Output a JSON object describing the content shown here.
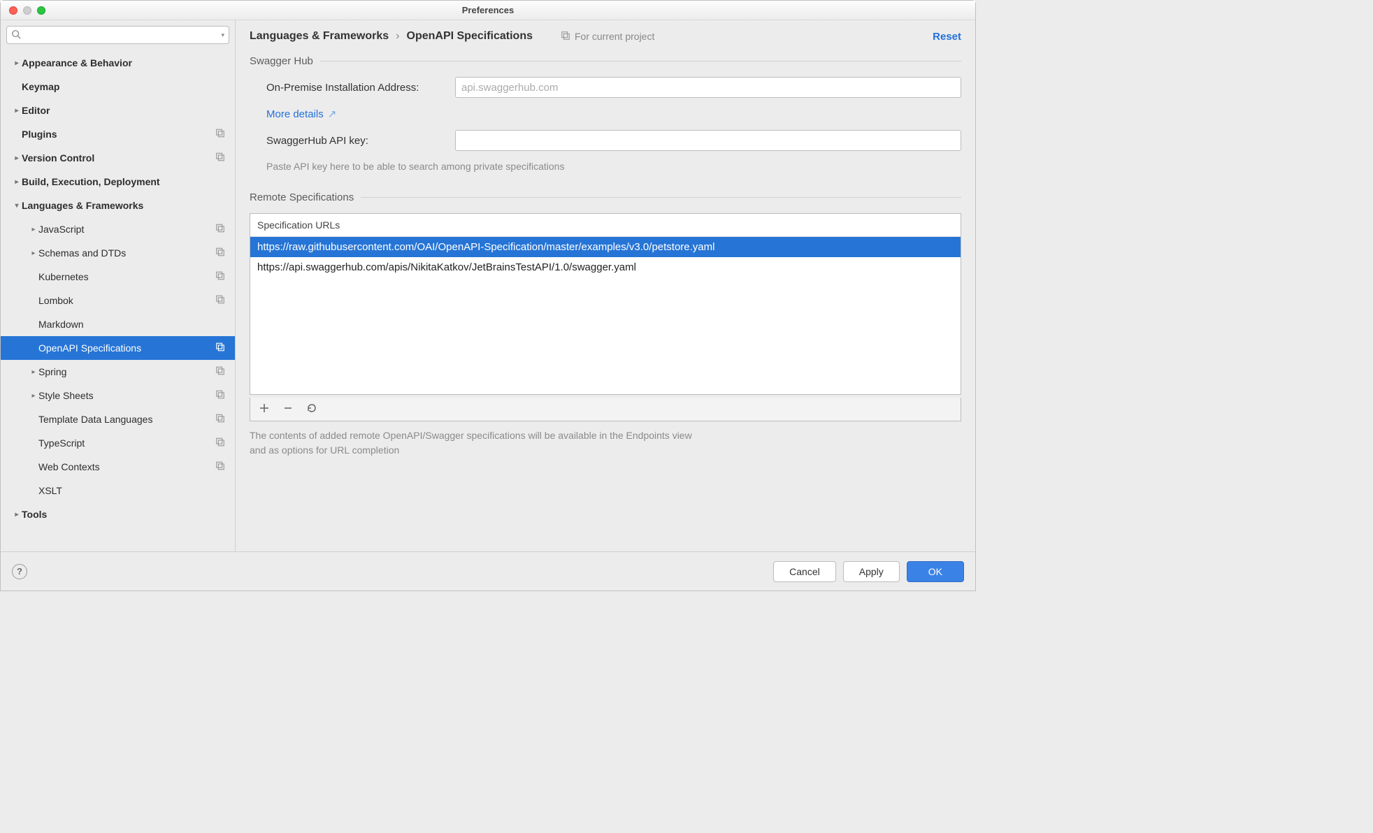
{
  "window": {
    "title": "Preferences"
  },
  "breadcrumb": {
    "parent": "Languages & Frameworks",
    "current": "OpenAPI Specifications"
  },
  "scope_label": "For current project",
  "reset_label": "Reset",
  "sidebar": {
    "search_placeholder": "",
    "items": [
      {
        "label": "Appearance & Behavior",
        "bold": true,
        "expandable": true,
        "expanded": false
      },
      {
        "label": "Keymap",
        "bold": true,
        "expandable": false
      },
      {
        "label": "Editor",
        "bold": true,
        "expandable": true,
        "expanded": false
      },
      {
        "label": "Plugins",
        "bold": true,
        "expandable": false,
        "copy": true
      },
      {
        "label": "Version Control",
        "bold": true,
        "expandable": true,
        "expanded": false,
        "copy": true
      },
      {
        "label": "Build, Execution, Deployment",
        "bold": true,
        "expandable": true,
        "expanded": false
      },
      {
        "label": "Languages & Frameworks",
        "bold": true,
        "expandable": true,
        "expanded": true,
        "children": [
          {
            "label": "JavaScript",
            "expandable": true,
            "copy": true
          },
          {
            "label": "Schemas and DTDs",
            "expandable": true,
            "copy": true
          },
          {
            "label": "Kubernetes",
            "copy": true
          },
          {
            "label": "Lombok",
            "copy": true
          },
          {
            "label": "Markdown"
          },
          {
            "label": "OpenAPI Specifications",
            "selected": true,
            "copy": true
          },
          {
            "label": "Spring",
            "expandable": true,
            "copy": true
          },
          {
            "label": "Style Sheets",
            "expandable": true,
            "copy": true
          },
          {
            "label": "Template Data Languages",
            "copy": true
          },
          {
            "label": "TypeScript",
            "copy": true
          },
          {
            "label": "Web Contexts",
            "copy": true
          },
          {
            "label": "XSLT"
          }
        ]
      },
      {
        "label": "Tools",
        "bold": true,
        "expandable": true,
        "expanded": false
      }
    ]
  },
  "swaggerhub": {
    "section": "Swagger Hub",
    "onprem_label": "On-Premise Installation Address:",
    "onprem_value": "api.swaggerhub.com",
    "more_details": "More details",
    "apikey_label": "SwaggerHub API key:",
    "apikey_value": "",
    "apikey_hint": "Paste API key here to be able to search among private specifications"
  },
  "remote": {
    "section": "Remote Specifications",
    "header": "Specification URLs",
    "rows": [
      {
        "url": "https://raw.githubusercontent.com/OAI/OpenAPI-Specification/master/examples/v3.0/petstore.yaml",
        "selected": true
      },
      {
        "url": "https://api.swaggerhub.com/apis/NikitaKatkov/JetBrainsTestAPI/1.0/swagger.yaml",
        "selected": false
      }
    ],
    "hint": "The contents of added remote OpenAPI/Swagger specifications will be available in the Endpoints view and as options for URL completion"
  },
  "footer": {
    "cancel": "Cancel",
    "apply": "Apply",
    "ok": "OK"
  }
}
